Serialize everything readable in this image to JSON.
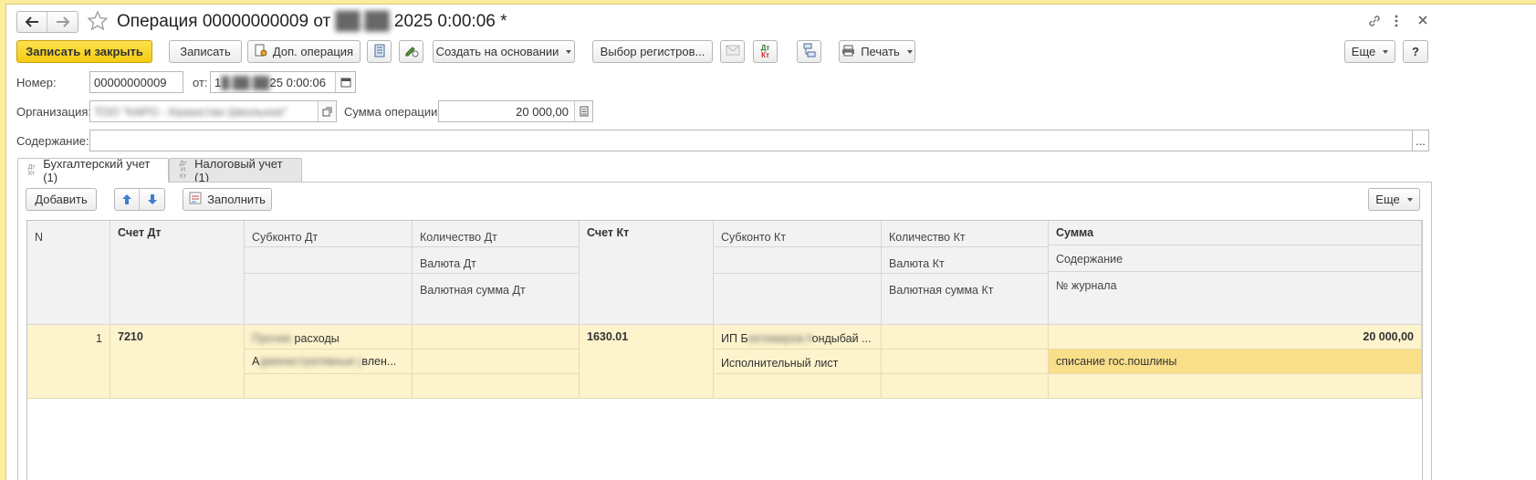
{
  "window": {
    "title": "Операция 00000000009 от",
    "title_date_hidden": "██.██.",
    "title_date_rest": "2025 0:00:06 *"
  },
  "toolbar": {
    "save_close": "Записать и закрыть",
    "save": "Записать",
    "extra_op": "Доп. операция",
    "create_basis": "Создать на основании",
    "registers": "Выбор регистров...",
    "print": "Печать",
    "more": "Еще",
    "help": "?"
  },
  "form": {
    "number_label": "Номер:",
    "number_value": "00000000009",
    "from_label": "от:",
    "date_prefix": "1",
    "date_hidden": "█.██.██",
    "date_suffix": "25  0:00:06",
    "org_label": "Организация:",
    "org_value": "ТОО \"КАРО - Казахстан Школьное\"",
    "sum_label": "Сумма операции:",
    "sum_value": "20 000,00",
    "content_label": "Содержание:",
    "content_value": "",
    "content_btn": "..."
  },
  "tabs": [
    {
      "label": "Бухгалтерский учет (1)",
      "icon_top": "Дт",
      "icon_bottom": "Кт"
    },
    {
      "label": "Налоговый учет (1)",
      "icon_top": "Дт Н",
      "icon_bottom": "Кт"
    }
  ],
  "table_toolbar": {
    "add": "Добавить",
    "fill": "Заполнить",
    "more": "Еще"
  },
  "table": {
    "headers": {
      "n": "N",
      "acc_dt": "Счет Дт",
      "sub_dt": "Субконто Дт",
      "qty_dt": "Количество Дт",
      "cur_dt": "Валюта Дт",
      "cursum_dt": "Валютная сумма Дт",
      "acc_kt": "Счет Кт",
      "sub_kt": "Субконто Кт",
      "qty_kt": "Количество Кт",
      "cur_kt": "Валюта Кт",
      "cursum_kt": "Валютная сумма Кт",
      "sum": "Сумма",
      "content": "Содержание",
      "journal": "№ журнала"
    },
    "rows": [
      {
        "n": "1",
        "acc_dt": "7210",
        "sub_dt_1_hidden": "Прочие",
        "sub_dt_1": "расходы",
        "sub_dt_2_start": "А",
        "sub_dt_2_hidden": "дминистративные расходы упра",
        "sub_dt_2_end": "влен...",
        "acc_kt": "1630.01",
        "sub_kt_1_start": "ИП Б",
        "sub_kt_1_hidden": "ектемиров Канат К",
        "sub_kt_1_end": "ондыбай ...",
        "sub_kt_2": "Исполнительный лист",
        "sum": "20 000,00",
        "content": "списание гос.пошлины"
      }
    ]
  }
}
